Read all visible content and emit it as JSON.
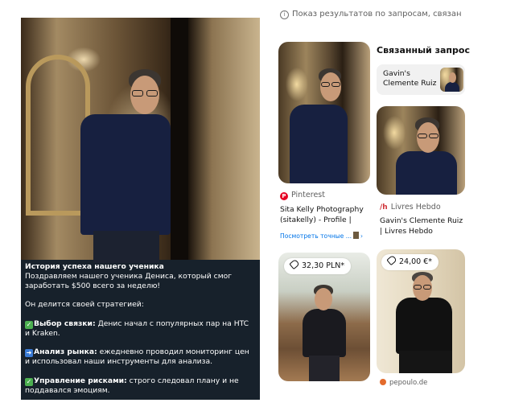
{
  "left_post": {
    "top_cropped_text": "",
    "title": "История успеха нашего ученика",
    "intro": "Поздравляем нашего ученика Дениса, который смог заработать $500 всего за неделю!",
    "strategy_line": "Он делится своей стратегией:",
    "points": [
      {
        "icon": "check-mark-icon",
        "label": "Выбор связки:",
        "text": " Денис начал с популярных пар на HTC и Kraken."
      },
      {
        "icon": "arrow-right-icon",
        "label": "Анализ рынка:",
        "text": " ежедневно проводил мониторинг цен и использовал наши инструменты для анализа."
      },
      {
        "icon": "check-mark-icon",
        "label": "Управление рисками:",
        "text": " строго следовал плану и не поддавался эмоциям."
      }
    ]
  },
  "right_panel": {
    "info_text": "Показ результатов по запросам, связан",
    "related": {
      "title": "Связанный запрос",
      "card_label": "Gavin's Clemente Ruiz"
    },
    "results": [
      {
        "source": "Pinterest",
        "description": "Sita Kelly Photography (sitakelly) - Profile |",
        "more_link": "Посмотреть точные ..."
      },
      {
        "source": "Livres Hebdo",
        "description": "Gavin's Clemente Ruiz | Livres Hebdo"
      },
      {
        "price": "32,30 PLN*"
      },
      {
        "price": "24,00 €*",
        "source": "pepoulo.de"
      }
    ]
  },
  "colors": {
    "post_bg": "#17212b",
    "pinterest_red": "#e60023",
    "link_blue": "#0074e8",
    "livres_hebdo_red": "#d0343a"
  }
}
